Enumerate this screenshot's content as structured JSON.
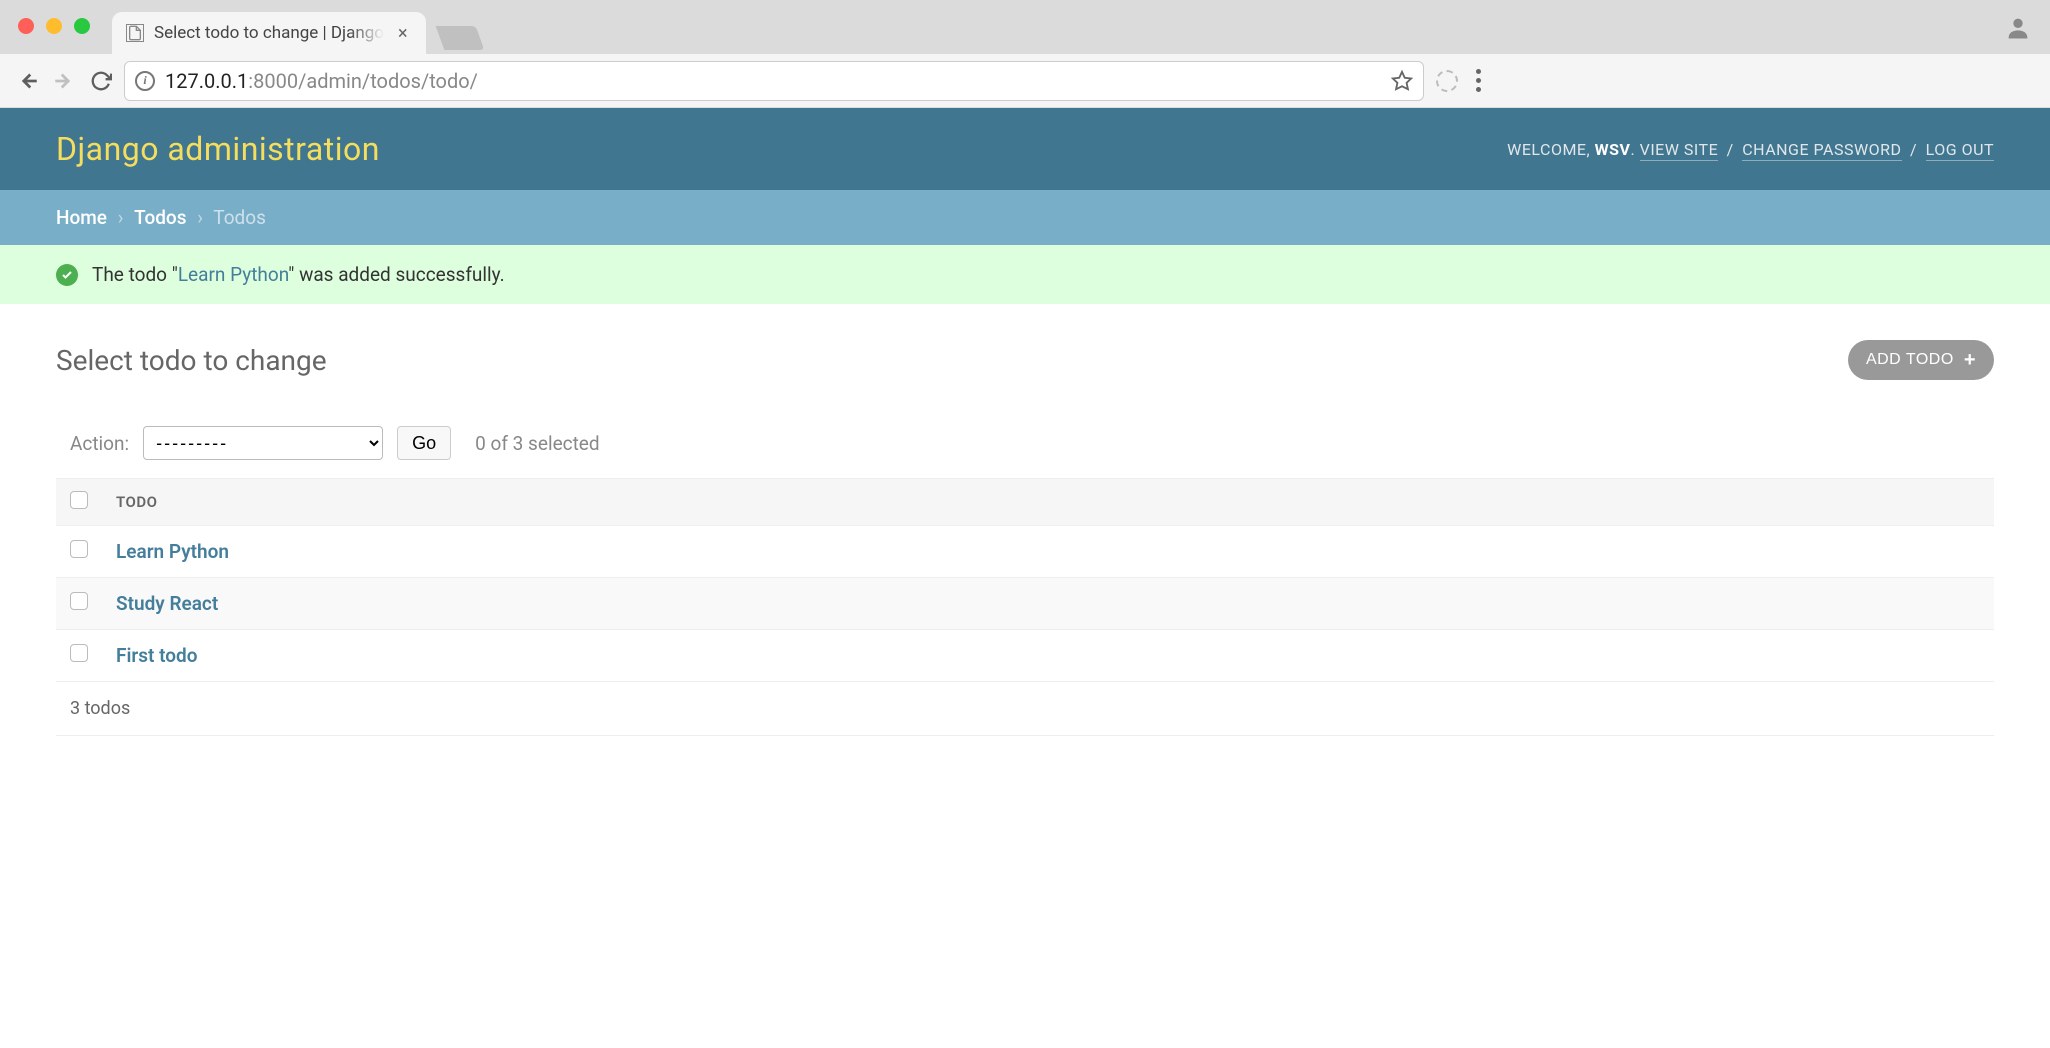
{
  "browser": {
    "tab_title": "Select todo to change | Django",
    "url_host": "127.0.0.1",
    "url_port": ":8000",
    "url_path": "/admin/todos/todo/"
  },
  "header": {
    "site_title": "Django administration",
    "welcome_prefix": "WELCOME, ",
    "username": "WSV",
    "view_site": "VIEW SITE",
    "change_password": "CHANGE PASSWORD",
    "logout": "LOG OUT"
  },
  "breadcrumbs": {
    "home": "Home",
    "app": "Todos",
    "current": "Todos"
  },
  "message": {
    "prefix": "The todo \"",
    "link": "Learn Python",
    "suffix": "\" was added successfully."
  },
  "content": {
    "title": "Select todo to change",
    "add_button": "ADD TODO"
  },
  "actions": {
    "label": "Action:",
    "placeholder": "---------",
    "go": "Go",
    "selection": "0 of 3 selected"
  },
  "table": {
    "header": "TODO",
    "rows": [
      {
        "title": "Learn Python"
      },
      {
        "title": "Study React"
      },
      {
        "title": "First todo"
      }
    ]
  },
  "paginator": {
    "text": "3 todos"
  }
}
